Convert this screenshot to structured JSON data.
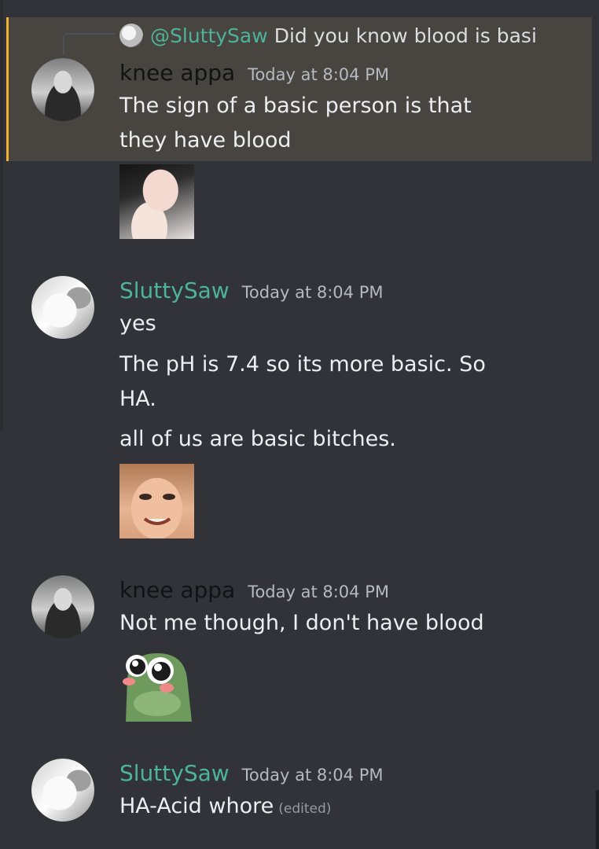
{
  "reply": {
    "author": "@SluttySaw",
    "snippet": "Did you know blood is basi"
  },
  "messages": [
    {
      "author": "knee appa",
      "timestamp": "Today at 8:04 PM",
      "lines": [
        "The sign of a basic person is that",
        "they have blood"
      ]
    },
    {
      "author": "SluttySaw",
      "timestamp": "Today at 8:04 PM",
      "lines": [
        "yes",
        "The pH is 7.4 so its more basic. So",
        "HA.",
        "all of us are basic bitches."
      ]
    },
    {
      "author": "knee appa",
      "timestamp": "Today at 8:04 PM",
      "lines": [
        "Not me though, I don't have blood"
      ]
    },
    {
      "author": "SluttySaw",
      "timestamp": "Today at 8:04 PM",
      "lines": [
        "HA-Acid whore"
      ],
      "edited": "(edited)"
    }
  ],
  "colors": {
    "background": "#313338",
    "mention_highlight": "#48443f",
    "mention_bar": "#f0b232",
    "author_teal": "#4db39a"
  },
  "icons": {
    "stickers": [
      "girl-praying-sticker",
      "smiling-kid-sticker",
      "blushing-frog-sticker"
    ]
  }
}
